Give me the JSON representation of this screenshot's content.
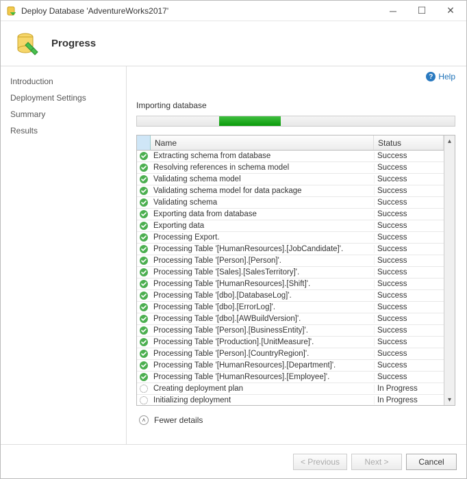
{
  "window": {
    "title": "Deploy Database 'AdventureWorks2017'"
  },
  "header": {
    "title": "Progress"
  },
  "sidebar": {
    "items": [
      {
        "label": "Introduction"
      },
      {
        "label": "Deployment Settings"
      },
      {
        "label": "Summary"
      },
      {
        "label": "Results"
      }
    ]
  },
  "help": {
    "label": "Help"
  },
  "progress": {
    "status_text": "Importing database"
  },
  "table": {
    "columns": {
      "name": "Name",
      "status": "Status"
    },
    "rows": [
      {
        "name": "Extracting schema from database",
        "status": "Success",
        "state": "success"
      },
      {
        "name": "Resolving references in schema model",
        "status": "Success",
        "state": "success"
      },
      {
        "name": "Validating schema model",
        "status": "Success",
        "state": "success"
      },
      {
        "name": "Validating schema model for data package",
        "status": "Success",
        "state": "success"
      },
      {
        "name": "Validating schema",
        "status": "Success",
        "state": "success"
      },
      {
        "name": "Exporting data from database",
        "status": "Success",
        "state": "success"
      },
      {
        "name": "Exporting data",
        "status": "Success",
        "state": "success"
      },
      {
        "name": "Processing Export.",
        "status": "Success",
        "state": "success"
      },
      {
        "name": "Processing Table '[HumanResources].[JobCandidate]'.",
        "status": "Success",
        "state": "success"
      },
      {
        "name": "Processing Table '[Person].[Person]'.",
        "status": "Success",
        "state": "success"
      },
      {
        "name": "Processing Table '[Sales].[SalesTerritory]'.",
        "status": "Success",
        "state": "success"
      },
      {
        "name": "Processing Table '[HumanResources].[Shift]'.",
        "status": "Success",
        "state": "success"
      },
      {
        "name": "Processing Table '[dbo].[DatabaseLog]'.",
        "status": "Success",
        "state": "success"
      },
      {
        "name": "Processing Table '[dbo].[ErrorLog]'.",
        "status": "Success",
        "state": "success"
      },
      {
        "name": "Processing Table '[dbo].[AWBuildVersion]'.",
        "status": "Success",
        "state": "success"
      },
      {
        "name": "Processing Table '[Person].[BusinessEntity]'.",
        "status": "Success",
        "state": "success"
      },
      {
        "name": "Processing Table '[Production].[UnitMeasure]'.",
        "status": "Success",
        "state": "success"
      },
      {
        "name": "Processing Table '[Person].[CountryRegion]'.",
        "status": "Success",
        "state": "success"
      },
      {
        "name": "Processing Table '[HumanResources].[Department]'.",
        "status": "Success",
        "state": "success"
      },
      {
        "name": "Processing Table '[HumanResources].[Employee]'.",
        "status": "Success",
        "state": "success"
      },
      {
        "name": "Creating deployment plan",
        "status": "In Progress",
        "state": "progress"
      },
      {
        "name": "Initializing deployment",
        "status": "In Progress",
        "state": "progress"
      }
    ]
  },
  "details_toggle": {
    "label": "Fewer details"
  },
  "footer": {
    "previous": "< Previous",
    "next": "Next >",
    "cancel": "Cancel"
  }
}
